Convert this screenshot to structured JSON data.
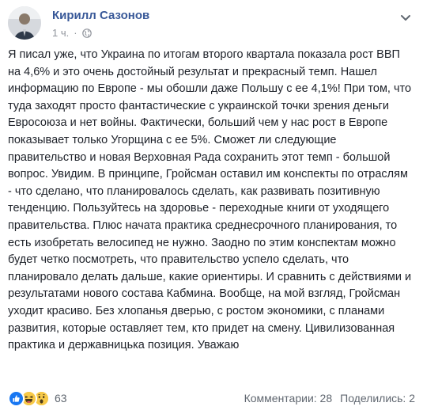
{
  "post": {
    "author": "Кирилл Сазонов",
    "time": "1 ч.",
    "separator": "·",
    "paragraphs": [
      "Я писал уже, что Украина по итогам второго квартала показала рост ВВП на 4,6% и это очень достойный результат и прекрасный темп. Нашел информацию по Европе - мы обошли даже Польшу с ее 4,1%! При том, что туда заходят просто фантастические с украинской точки зрения деньги Евросоюза и нет войны. Фактически, больший чем у нас рост в Европе показывает только Угорщина с ее 5%. Сможет ли следующие правительство и новая Верховная Рада сохранить этот темп - большой вопрос. Увидим. В принципе, Гройсман оставил им конспекты по отраслям - что сделано, что планировалось сделать, как развивать позитивную тенденцию. Пользуйтесь на здоровье - переходные книги от уходящего правительства. Плюс начата практика среднесрочного планирования, то есть изобретать велосипед не нужно. Заодно по этим конспектам можно будет четко посмотреть, что правительство успело сделать, что планировало делать дальше, какие ориентиры. И сравнить с действиями и результатами нового состава Кабмина. Вообще, на мой взгляд, Гройсман уходит красиво. Без хлопанья дверью, с ростом экономики, с планами развития, которые оставляет тем, кто придет на смену. Цивилизованная практика и державницька позиция. Уважаю"
    ]
  },
  "reactions": {
    "icons": [
      "like-icon",
      "haha-icon",
      "wow-icon"
    ],
    "count": "63"
  },
  "stats": {
    "comments": "Комментарии: 28",
    "shares": "Поделились: 2"
  }
}
